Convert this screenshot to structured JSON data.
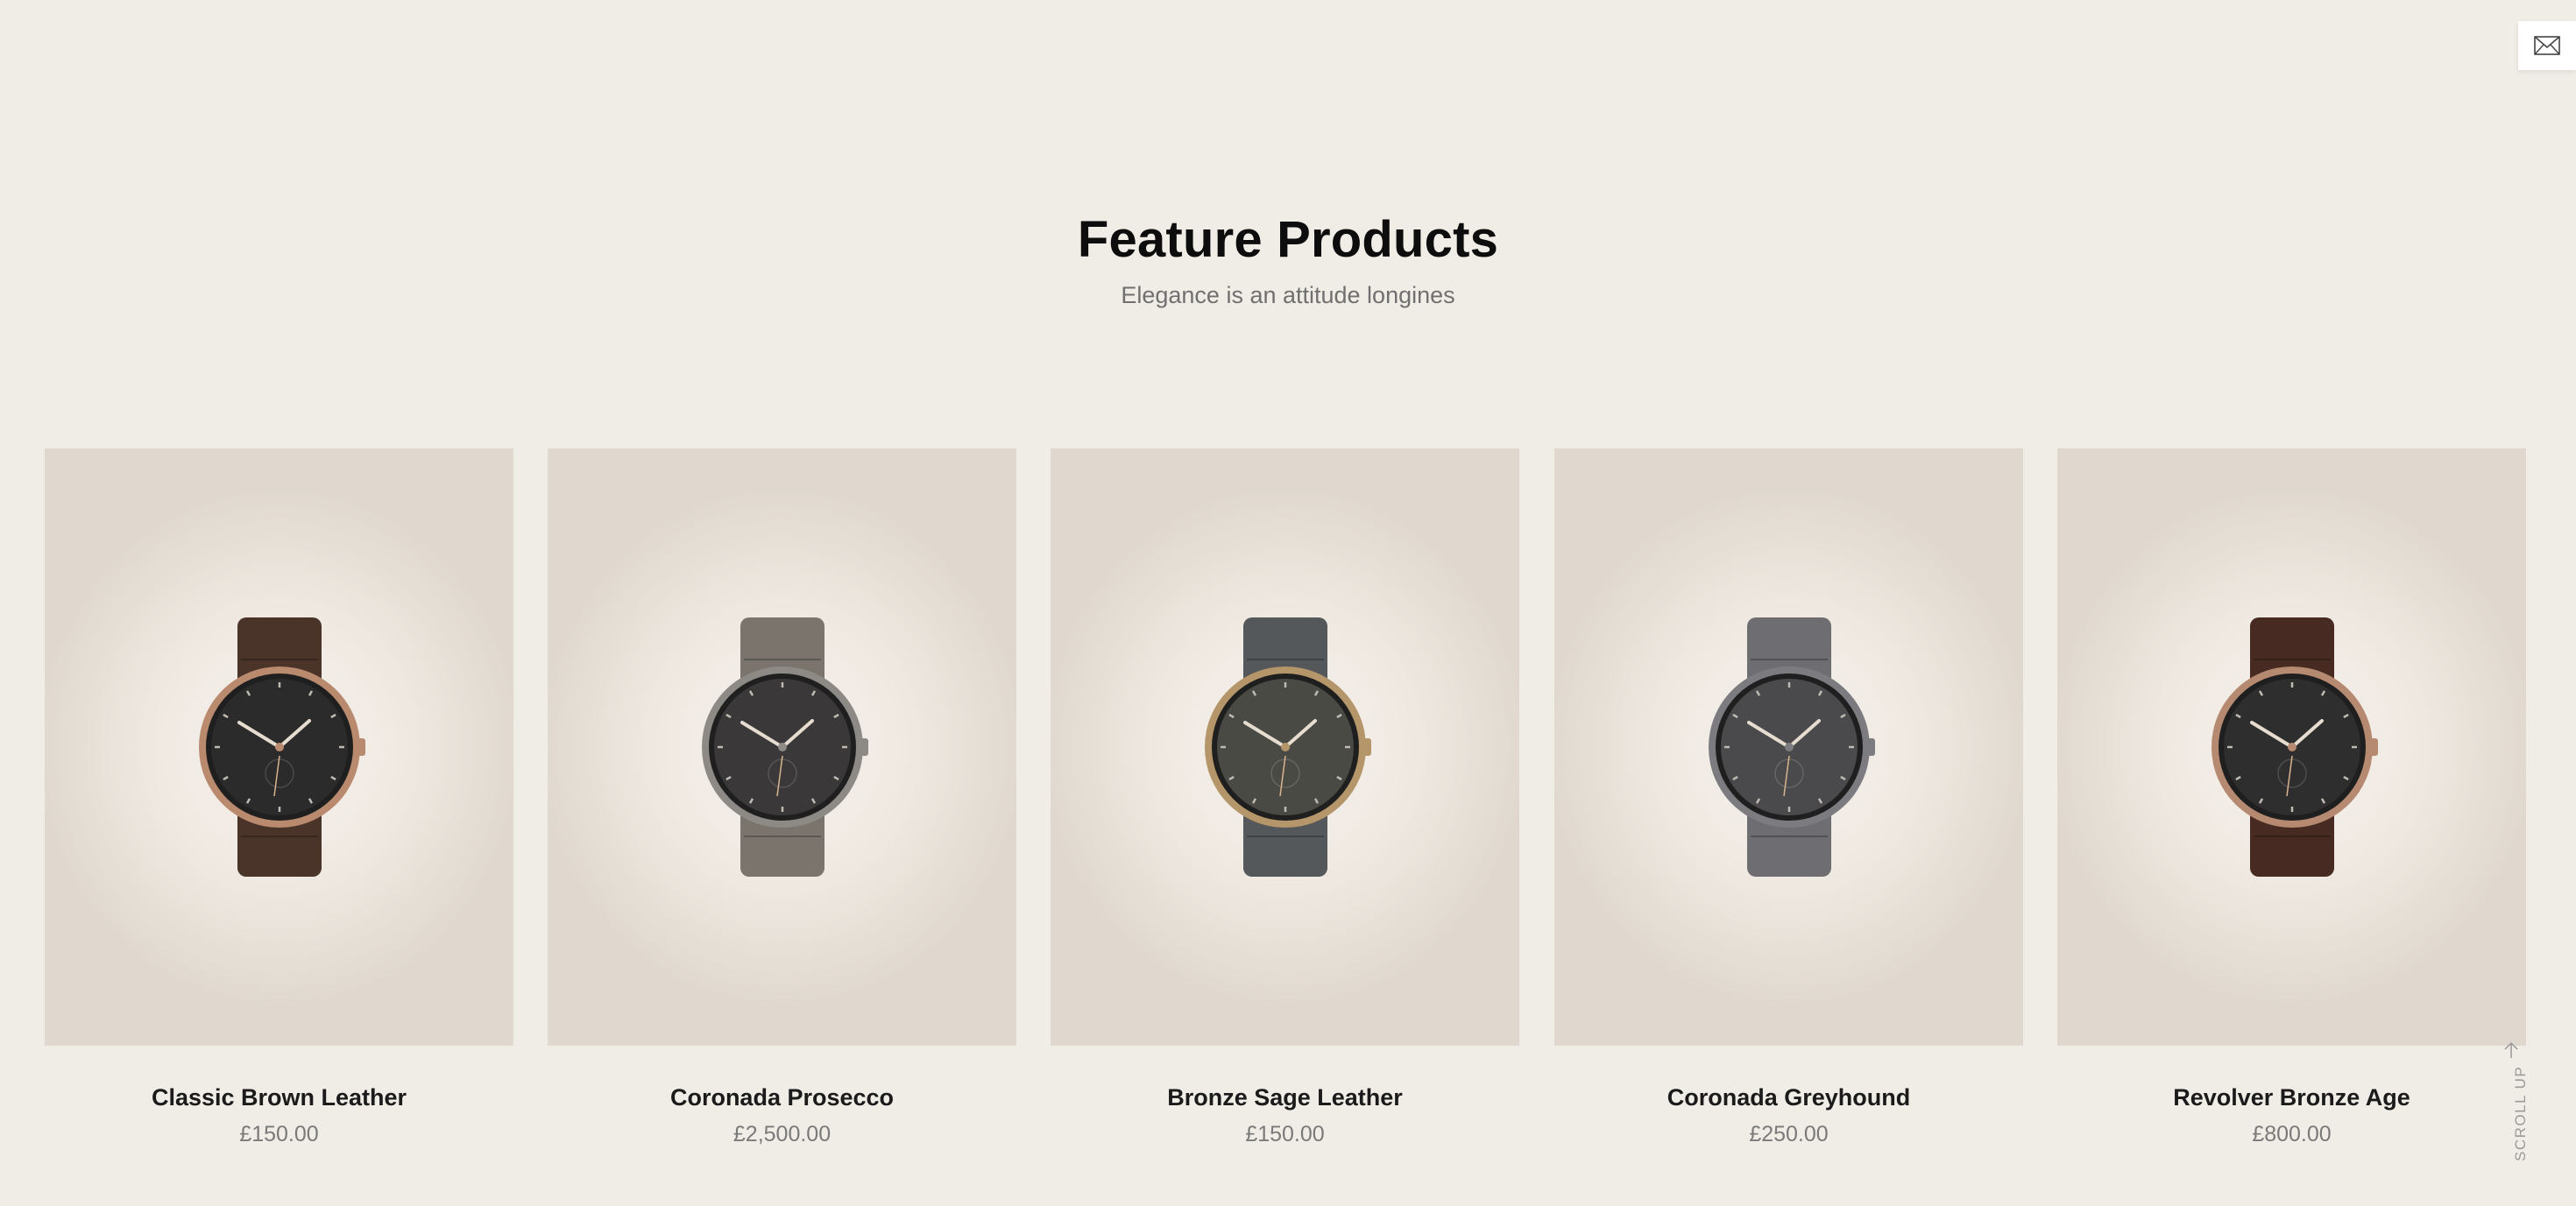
{
  "header": {
    "mail_icon": "envelope-icon",
    "title": "Feature Products",
    "subtitle": "Elegance is an attitude longines"
  },
  "products": [
    {
      "name": "Classic Brown Leather",
      "price": "£150.00",
      "strap": "#4a3328",
      "case": "#b98a6e",
      "dial": "#2b2b2b"
    },
    {
      "name": "Coronada Prosecco",
      "price": "£2,500.00",
      "strap": "#7a746c",
      "case": "#8d8a86",
      "dial": "#3a3838"
    },
    {
      "name": "Bronze Sage Leather",
      "price": "£150.00",
      "strap": "#55585a",
      "case": "#b4966a",
      "dial": "#4a4a45"
    },
    {
      "name": "Coronada Greyhound",
      "price": "£250.00",
      "strap": "#6e6e72",
      "case": "#7c7c80",
      "dial": "#4a4a4c"
    },
    {
      "name": "Revolver Bronze Age",
      "price": "£800.00",
      "strap": "#472a22",
      "case": "#b58a70",
      "dial": "#2e2e2e"
    }
  ],
  "scroll_up": {
    "label": "SCROLL UP",
    "icon": "arrow-up-icon"
  }
}
